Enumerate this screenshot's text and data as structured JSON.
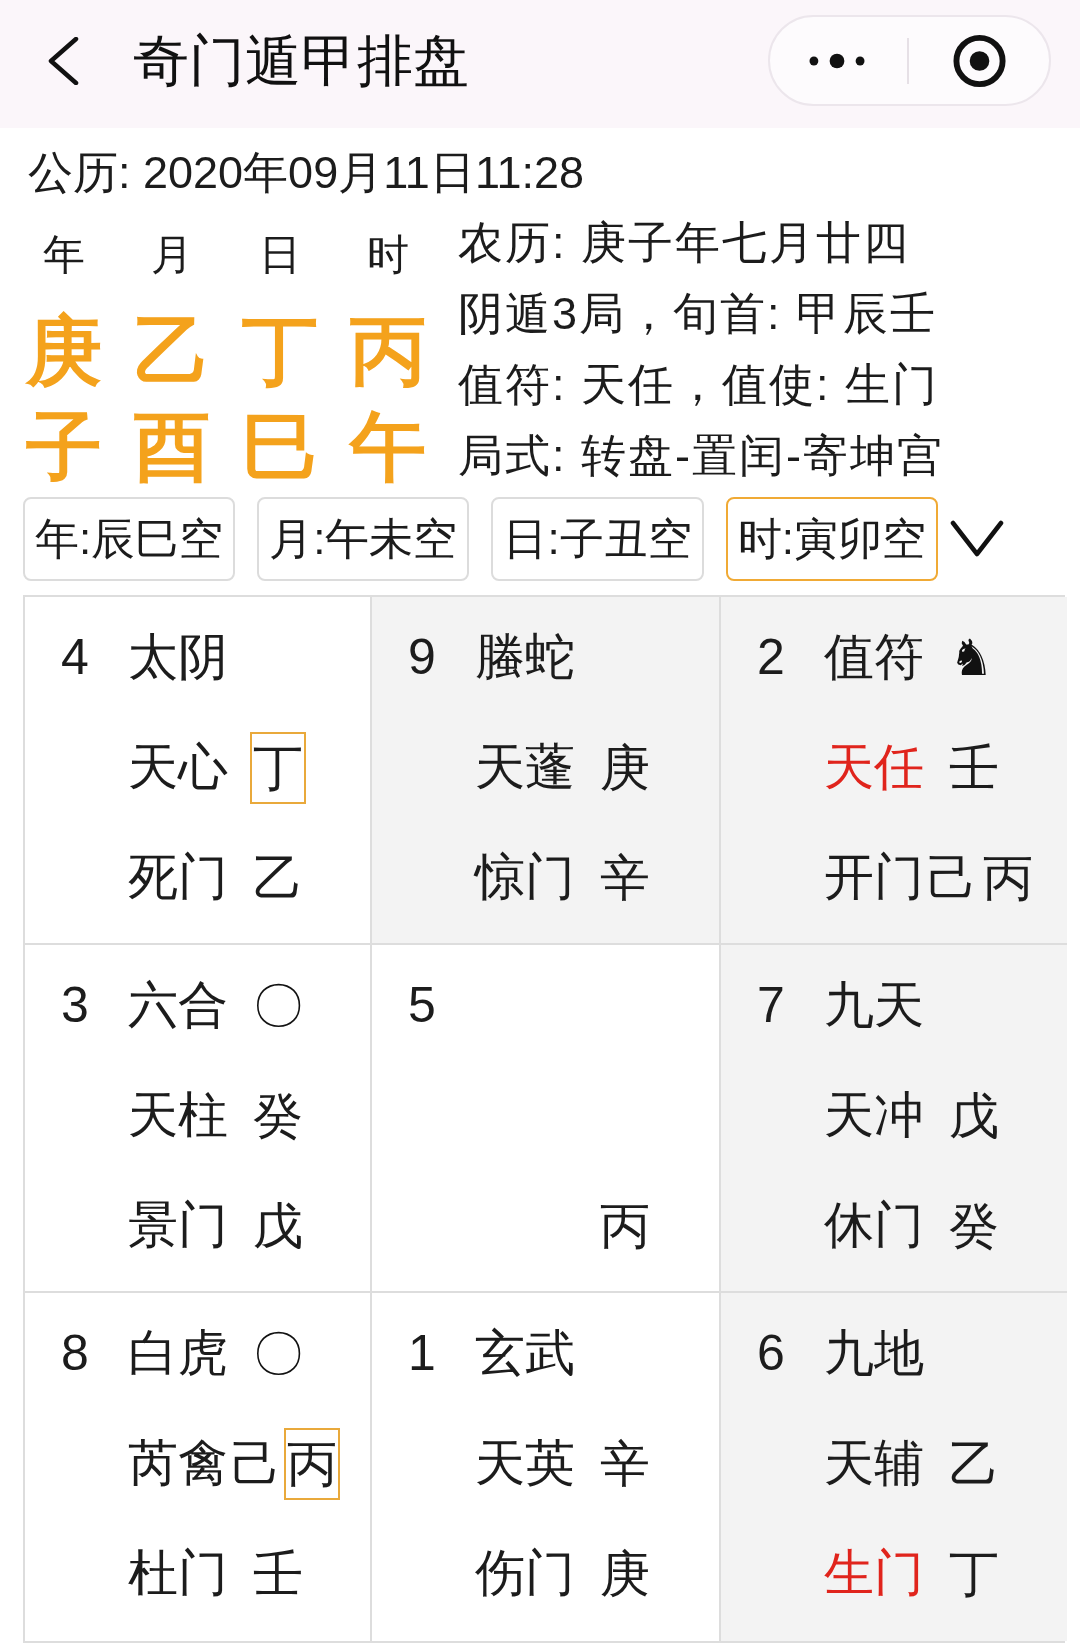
{
  "header": {
    "title": "奇门遁甲排盘"
  },
  "gregorian": "公历: 2020年09月11日11:28",
  "pillars": [
    {
      "label": "年",
      "stem": "庚",
      "branch": "子"
    },
    {
      "label": "月",
      "stem": "乙",
      "branch": "酉"
    },
    {
      "label": "日",
      "stem": "丁",
      "branch": "巳"
    },
    {
      "label": "时",
      "stem": "丙",
      "branch": "午"
    }
  ],
  "info_lines": [
    "农历: 庚子年七月廿四",
    "阴遁3局，旬首: 甲辰壬",
    "值符: 天任，值使: 生门",
    "局式: 转盘-置闰-寄坤宫"
  ],
  "void_tabs": [
    {
      "label": "年:辰巳空",
      "selected": false
    },
    {
      "label": "月:午未空",
      "selected": false
    },
    {
      "label": "日:子丑空",
      "selected": false
    },
    {
      "label": "时:寅卯空",
      "selected": true
    }
  ],
  "palaces": [
    {
      "number": "4",
      "deity": "太阴",
      "shaded": false,
      "star": {
        "text": "天心",
        "highlighted": false
      },
      "star_stems": [
        {
          "text": "丁",
          "boxed": true
        }
      ],
      "door": {
        "text": "死门",
        "highlighted": false
      },
      "door_stems": [
        {
          "text": "乙",
          "boxed": false
        }
      ]
    },
    {
      "number": "9",
      "deity": "螣蛇",
      "shaded": true,
      "star": {
        "text": "天蓬",
        "highlighted": false
      },
      "star_stems": [
        {
          "text": "庚",
          "boxed": false
        }
      ],
      "door": {
        "text": "惊门",
        "highlighted": false
      },
      "door_stems": [
        {
          "text": "辛",
          "boxed": false
        }
      ]
    },
    {
      "number": "2",
      "deity": "值符",
      "marker": "♞",
      "shaded": true,
      "star": {
        "text": "天任",
        "highlighted": true
      },
      "star_stems": [
        {
          "text": "壬",
          "boxed": false
        }
      ],
      "door": {
        "text": "开门",
        "highlighted": false
      },
      "door_stems": [
        {
          "text": "己",
          "boxed": false
        },
        {
          "text": "丙",
          "boxed": false
        }
      ]
    },
    {
      "number": "3",
      "deity": "六合",
      "marker": "〇",
      "shaded": false,
      "star": {
        "text": "天柱",
        "highlighted": false
      },
      "star_stems": [
        {
          "text": "癸",
          "boxed": false
        }
      ],
      "door": {
        "text": "景门",
        "highlighted": false
      },
      "door_stems": [
        {
          "text": "戊",
          "boxed": false
        }
      ]
    },
    {
      "number": "5",
      "shaded": false,
      "door_stems": [
        {
          "text": "丙",
          "boxed": false
        }
      ]
    },
    {
      "number": "7",
      "deity": "九天",
      "shaded": true,
      "star": {
        "text": "天冲",
        "highlighted": false
      },
      "star_stems": [
        {
          "text": "戊",
          "boxed": false
        }
      ],
      "door": {
        "text": "休门",
        "highlighted": false
      },
      "door_stems": [
        {
          "text": "癸",
          "boxed": false
        }
      ]
    },
    {
      "number": "8",
      "deity": "白虎",
      "marker": "〇",
      "shaded": false,
      "star": {
        "text": "芮禽",
        "highlighted": false
      },
      "star_stems": [
        {
          "text": "己",
          "boxed": false
        },
        {
          "text": "丙",
          "boxed": true
        }
      ],
      "door": {
        "text": "杜门",
        "highlighted": false
      },
      "door_stems": [
        {
          "text": "壬",
          "boxed": false
        }
      ]
    },
    {
      "number": "1",
      "deity": "玄武",
      "shaded": false,
      "star": {
        "text": "天英",
        "highlighted": false
      },
      "star_stems": [
        {
          "text": "辛",
          "boxed": false
        }
      ],
      "door": {
        "text": "伤门",
        "highlighted": false
      },
      "door_stems": [
        {
          "text": "庚",
          "boxed": false
        }
      ]
    },
    {
      "number": "6",
      "deity": "九地",
      "shaded": true,
      "star": {
        "text": "天辅",
        "highlighted": false
      },
      "star_stems": [
        {
          "text": "乙",
          "boxed": false
        }
      ],
      "door": {
        "text": "生门",
        "highlighted": true
      },
      "door_stems": [
        {
          "text": "丁",
          "boxed": false
        }
      ]
    }
  ]
}
